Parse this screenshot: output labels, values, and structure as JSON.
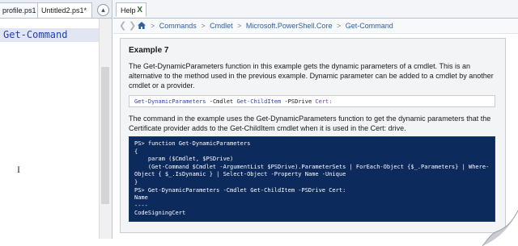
{
  "editor": {
    "tabs": [
      {
        "label": "profile.ps1"
      },
      {
        "label": "Untitled2.ps1*"
      }
    ],
    "collapse_glyph": "▴",
    "code_line": "Get-Command",
    "cursor_glyph": "I"
  },
  "help": {
    "tab_label": "Help",
    "tab_close": "X",
    "breadcrumb": {
      "back_glyph": "❮",
      "forward_glyph": "❯",
      "items": [
        "Commands",
        "Cmdlet",
        "Microsoft.PowerShell.Core",
        "Get-Command"
      ],
      "separator": ">"
    },
    "example_title": "Example 7",
    "description": "The Get-DynamicParameters function in this example gets the dynamic parameters of a cmdlet. This is an alternative to the method used in the previous example. Dynamic parameter can be added to a cmdlet by another cmdlet or a provider.",
    "command": {
      "cmd1": "Get-DynamicParameters",
      "param1": " -Cmdlet ",
      "cmd2": "Get-ChildItem",
      "param2": " -PSDrive ",
      "value": "Cert:"
    },
    "description2": "The command in the example uses the Get-DynamicParameters function to get the dynamic parameters that the Certificate provider adds to the Get-ChildItem cmdlet when it is used in the Cert: drive.",
    "console_lines": [
      "PS> function Get-DynamicParameters",
      "{",
      "    param ($Cmdlet, $PSDrive)",
      "    (Get-Command $Cmdlet -ArgumentList $PSDrive).ParameterSets | ForEach-Object {$_.Parameters} | Where-",
      "Object { $_.IsDynamic } | Select-Object -Property Name -Unique",
      "}",
      "PS> Get-DynamicParameters -Cmdlet Get-ChildItem -PSDrive Cert:",
      "",
      "Name",
      "----",
      "CodeSigningCert"
    ]
  },
  "colors": {
    "console_bg": "#0c2a5b",
    "link": "#2c5fa8",
    "code_text": "#1f3fb8",
    "code_line_bg": "#e2e6f2"
  }
}
